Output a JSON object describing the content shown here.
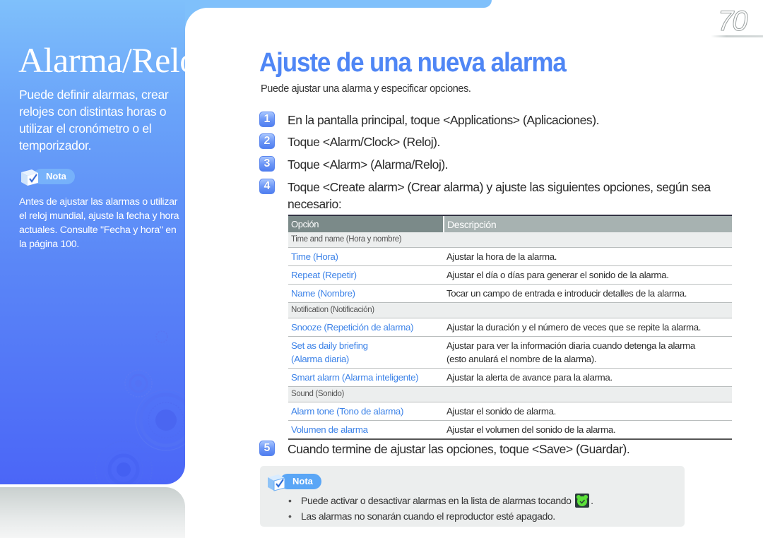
{
  "sidebar": {
    "title": "Alarma/Reloj",
    "intro": "Puede definir alarmas, crear relojes con distintas horas o utilizar el cronómetro o el temporizador.",
    "note_label": "Nota",
    "note_text": "Antes de ajustar las alarmas o utilizar el reloj mundial, ajuste la fecha y hora actuales. Consulte \"Fecha y hora\" en la página 100."
  },
  "page_number": "70",
  "main": {
    "title": "Ajuste de una nueva alarma",
    "subtitle": "Puede ajustar una alarma y especificar opciones.",
    "steps": [
      {
        "number": "1",
        "text": "En la pantalla principal, toque <Applications> (Aplicaciones)."
      },
      {
        "number": "2",
        "text": "Toque <Alarm/Clock> (Reloj)."
      },
      {
        "number": "3",
        "text": "Toque <Alarm> (Alarma/Reloj)."
      },
      {
        "number": "4",
        "text": "Toque <Create alarm> (Crear alarma) y ajuste las siguientes opciones, según sea necesario:"
      },
      {
        "number": "5",
        "text": "Cuando termine de ajustar las opciones, toque <Save> (Guardar)."
      }
    ],
    "table": {
      "headers": [
        "Opción",
        "Descripción"
      ],
      "sections": [
        {
          "name": "Time and name (Hora y nombre)",
          "rows": [
            {
              "option": "Time (Hora)",
              "description": "Ajustar la hora de la alarma."
            },
            {
              "option": "Repeat (Repetir)",
              "description": "Ajustar el día o días para generar el sonido de la alarma."
            },
            {
              "option": "Name (Nombre)",
              "description": "Tocar un campo de entrada e introducir detalles de la alarma."
            }
          ]
        },
        {
          "name": "Notification (Notificación)",
          "rows": [
            {
              "option": "Snooze (Repetición de alarma)",
              "description": "Ajustar la duración y el número de veces que se repite la alarma."
            },
            {
              "option": "Set as daily briefing (Alarma diaria)",
              "description": "Ajustar para ver la información diaria cuando detenga la alarma (esto anulará el nombre de la alarma)."
            },
            {
              "option": "Smart alarm (Alarma inteligente)",
              "description": "Ajustar la alerta de avance para la alarma."
            }
          ]
        },
        {
          "name": "Sound (Sonido)",
          "rows": [
            {
              "option": "Alarm tone (Tono de alarma)",
              "description": "Ajustar el sonido de alarma."
            },
            {
              "option": "Volumen de alarma",
              "description": "Ajustar el volumen del sonido de la alarma."
            }
          ]
        }
      ]
    },
    "note": {
      "label": "Nota",
      "items": [
        {
          "text_before": "Puede activar o desactivar alarmas en la lista de alarmas tocando",
          "icon": "alarm-toggle-icon",
          "text_after": "."
        },
        {
          "text_before": "Las alarmas no sonarán cuando el reproductor esté apagado.",
          "icon": "",
          "text_after": ""
        }
      ]
    }
  },
  "colors": {
    "accent_blue": "#4f86f5",
    "option_link_blue": "#3d83e8",
    "sidebar_top": "#7fc0fb",
    "sidebar_bottom": "#4b66f7",
    "table_header_option": "#7b8a89",
    "table_header_desc": "#a7b2b1",
    "note_bg": "#eceeee",
    "alarm_icon_green": "#5be13a"
  }
}
